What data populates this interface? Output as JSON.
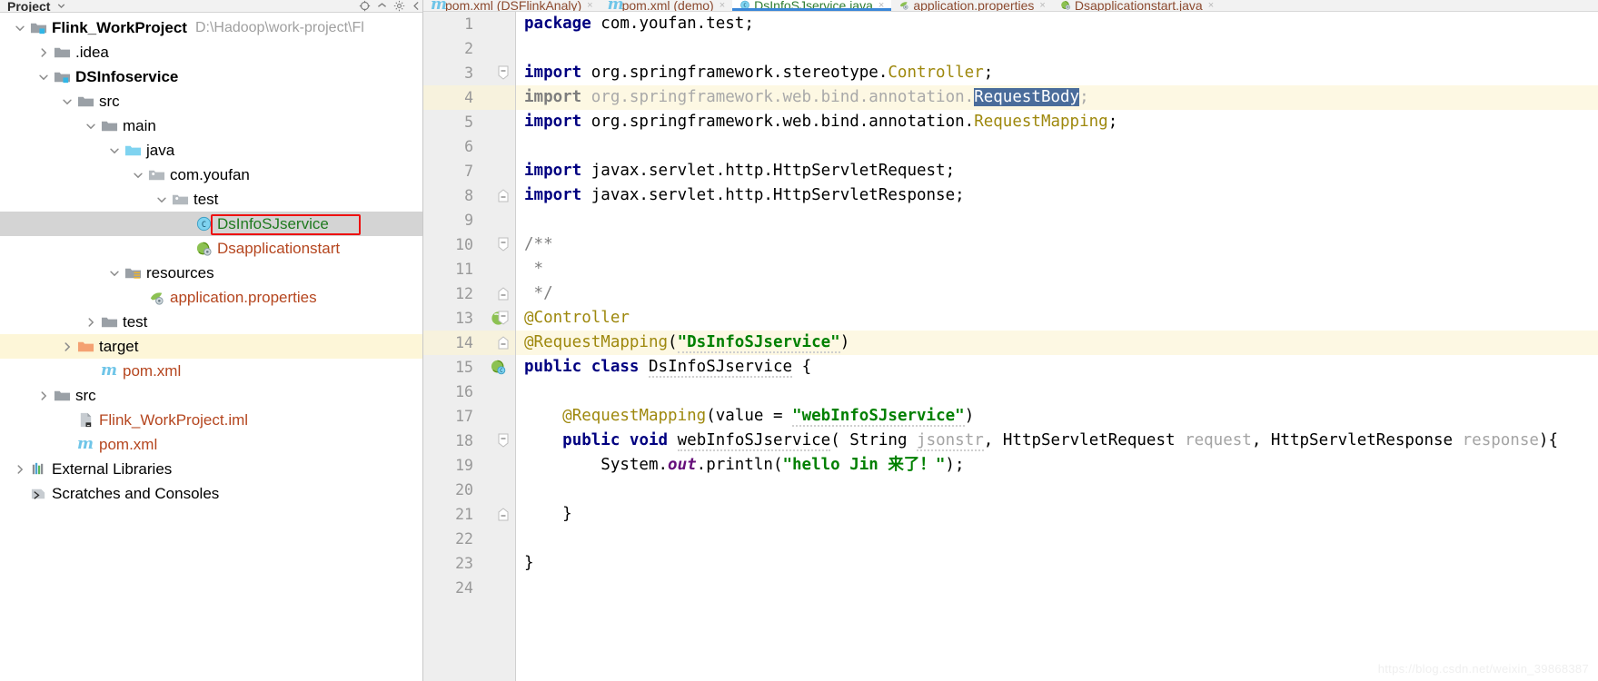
{
  "sidebar": {
    "header": {
      "title": "Project",
      "chevron": "chevron-down-icon",
      "icons": [
        "target-icon",
        "collapse-all-icon",
        "settings-icon"
      ]
    },
    "tree": [
      {
        "label": "Flink_WorkProject",
        "note": "D:\\Hadoop\\work-project\\Fl",
        "indent": 0,
        "twisty": "down",
        "icon": "module-folder-icon",
        "bold": true,
        "state": "normal"
      },
      {
        "label": ".idea",
        "note": "",
        "indent": 1,
        "twisty": "right",
        "icon": "folder-icon",
        "bold": false,
        "state": "normal"
      },
      {
        "label": "DSInfoservice",
        "note": "",
        "indent": 1,
        "twisty": "down",
        "icon": "module-folder-icon",
        "bold": true,
        "state": "normal"
      },
      {
        "label": "src",
        "note": "",
        "indent": 2,
        "twisty": "down",
        "icon": "folder-icon",
        "bold": false,
        "state": "normal"
      },
      {
        "label": "main",
        "note": "",
        "indent": 3,
        "twisty": "down",
        "icon": "folder-icon",
        "bold": false,
        "state": "normal"
      },
      {
        "label": "java",
        "note": "",
        "indent": 4,
        "twisty": "down",
        "icon": "source-root-folder-icon",
        "bold": false,
        "state": "normal"
      },
      {
        "label": "com.youfan",
        "note": "",
        "indent": 5,
        "twisty": "down",
        "icon": "package-icon",
        "bold": false,
        "state": "normal"
      },
      {
        "label": "test",
        "note": "",
        "indent": 6,
        "twisty": "down",
        "icon": "package-icon",
        "bold": false,
        "state": "normal"
      },
      {
        "label": "DsInfoSJservice",
        "note": "",
        "indent": 7,
        "twisty": "none",
        "icon": "java-class-icon",
        "bold": false,
        "state": "selected"
      },
      {
        "label": "Dsapplicationstart",
        "note": "",
        "indent": 7,
        "twisty": "none",
        "icon": "spring-boot-class-icon",
        "bold": false,
        "state": "normal"
      },
      {
        "label": "resources",
        "note": "",
        "indent": 4,
        "twisty": "down",
        "icon": "resources-folder-icon",
        "bold": false,
        "state": "normal"
      },
      {
        "label": "application.properties",
        "note": "",
        "indent": 5,
        "twisty": "none",
        "icon": "spring-properties-icon",
        "bold": false,
        "state": "normal"
      },
      {
        "label": "test",
        "note": "",
        "indent": 3,
        "twisty": "right",
        "icon": "folder-icon",
        "bold": false,
        "state": "normal"
      },
      {
        "label": "target",
        "note": "",
        "indent": 2,
        "twisty": "right",
        "icon": "excluded-folder-icon",
        "bold": false,
        "state": "hover"
      },
      {
        "label": "pom.xml",
        "note": "",
        "indent": 3,
        "twisty": "none",
        "icon": "maven-icon",
        "bold": false,
        "state": "normal"
      },
      {
        "label": "src",
        "note": "",
        "indent": 1,
        "twisty": "right",
        "icon": "folder-icon",
        "bold": false,
        "state": "normal"
      },
      {
        "label": "Flink_WorkProject.iml",
        "note": "",
        "indent": 2,
        "twisty": "none",
        "icon": "iml-file-icon",
        "bold": false,
        "state": "normal"
      },
      {
        "label": "pom.xml",
        "note": "",
        "indent": 2,
        "twisty": "none",
        "icon": "maven-icon",
        "bold": false,
        "state": "normal"
      },
      {
        "label": "External Libraries",
        "note": "",
        "indent": 0,
        "twisty": "right",
        "icon": "libraries-icon",
        "bold": false,
        "state": "normal"
      },
      {
        "label": "Scratches and Consoles",
        "note": "",
        "indent": 0,
        "twisty": "none",
        "icon": "scratches-icon",
        "bold": false,
        "state": "normal"
      }
    ]
  },
  "editor": {
    "tabs": [
      {
        "label": "pom.xml (DSFlinkAnaly)",
        "icon": "maven-icon",
        "active": false
      },
      {
        "label": "pom.xml (demo)",
        "icon": "maven-icon",
        "active": false
      },
      {
        "label": "DsInfoSJservice.java",
        "icon": "java-class-icon",
        "active": true
      },
      {
        "label": "application.properties",
        "icon": "spring-properties-icon",
        "active": false
      },
      {
        "label": "Dsapplicationstart.java",
        "icon": "spring-boot-class-icon",
        "active": false
      }
    ],
    "selection": "RequestBody",
    "first_line_number": 1,
    "last_line_number": 24,
    "lines": [
      {
        "n": 1,
        "fold": "none",
        "gicon": "none",
        "hl": false,
        "text": "package com.youfan.test;"
      },
      {
        "n": 2,
        "fold": "none",
        "gicon": "none",
        "hl": false,
        "text": ""
      },
      {
        "n": 3,
        "fold": "start",
        "gicon": "none",
        "hl": false,
        "text": "import org.springframework.stereotype.Controller;"
      },
      {
        "n": 4,
        "fold": "none",
        "gicon": "none",
        "hl": true,
        "text": "import org.springframework.web.bind.annotation.RequestBody;"
      },
      {
        "n": 5,
        "fold": "none",
        "gicon": "none",
        "hl": false,
        "text": "import org.springframework.web.bind.annotation.RequestMapping;"
      },
      {
        "n": 6,
        "fold": "none",
        "gicon": "none",
        "hl": false,
        "text": ""
      },
      {
        "n": 7,
        "fold": "none",
        "gicon": "none",
        "hl": false,
        "text": "import javax.servlet.http.HttpServletRequest;"
      },
      {
        "n": 8,
        "fold": "end",
        "gicon": "none",
        "hl": false,
        "text": "import javax.servlet.http.HttpServletResponse;"
      },
      {
        "n": 9,
        "fold": "none",
        "gicon": "none",
        "hl": false,
        "text": ""
      },
      {
        "n": 10,
        "fold": "start",
        "gicon": "none",
        "hl": false,
        "text": "/**"
      },
      {
        "n": 11,
        "fold": "none",
        "gicon": "none",
        "hl": false,
        "text": " *"
      },
      {
        "n": 12,
        "fold": "end",
        "gicon": "none",
        "hl": false,
        "text": " */"
      },
      {
        "n": 13,
        "fold": "start",
        "gicon": "spring-bean-icon",
        "hl": false,
        "text": "@Controller"
      },
      {
        "n": 14,
        "fold": "end",
        "gicon": "none",
        "hl": true,
        "text": "@RequestMapping(\"DsInfoSJservice\")"
      },
      {
        "n": 15,
        "fold": "none",
        "gicon": "spring-mvc-icon",
        "hl": false,
        "text": "public class DsInfoSJservice {"
      },
      {
        "n": 16,
        "fold": "none",
        "gicon": "none",
        "hl": false,
        "text": ""
      },
      {
        "n": 17,
        "fold": "none",
        "gicon": "none",
        "hl": false,
        "text": "    @RequestMapping(value = \"webInfoSJservice\")"
      },
      {
        "n": 18,
        "fold": "start",
        "gicon": "none",
        "hl": false,
        "text": "    public void webInfoSJservice( String jsonstr, HttpServletRequest request, HttpServletResponse response){"
      },
      {
        "n": 19,
        "fold": "none",
        "gicon": "none",
        "hl": false,
        "text": "        System.out.println(\"hello Jin 来了！\");"
      },
      {
        "n": 20,
        "fold": "none",
        "gicon": "none",
        "hl": false,
        "text": ""
      },
      {
        "n": 21,
        "fold": "end",
        "gicon": "none",
        "hl": false,
        "text": "    }"
      },
      {
        "n": 22,
        "fold": "none",
        "gicon": "none",
        "hl": false,
        "text": ""
      },
      {
        "n": 23,
        "fold": "none",
        "gicon": "none",
        "hl": false,
        "text": "}"
      },
      {
        "n": 24,
        "fold": "none",
        "gicon": "none",
        "hl": false,
        "text": ""
      }
    ]
  },
  "watermark": "https://blog.csdn.net/weixin_39868387",
  "colors": {
    "selection_blue": "#4a6c9b",
    "highlight_line": "#fdf8e3",
    "selected_row": "#d4d4d4",
    "red_box": "#ee1111",
    "keyword": "#000080",
    "string": "#008000",
    "annotation": "#9e880d",
    "comment": "#808080",
    "active_tab": "#3a87d8"
  }
}
